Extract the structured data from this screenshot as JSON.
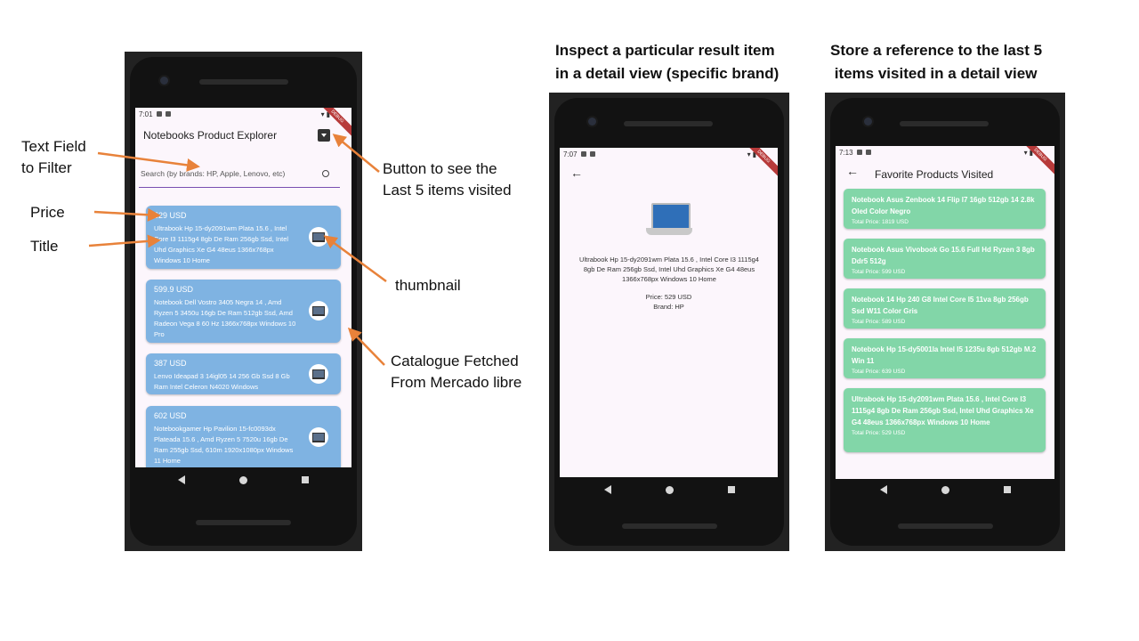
{
  "annotations": {
    "text_field": "Text Field\nto Filter",
    "price": "Price",
    "title": "Title",
    "button": "Button to see the\nLast 5 items visited",
    "thumbnail": "thumbnail",
    "catalogue": "Catalogue Fetched\nFrom Mercado libre",
    "detail_heading": "Inspect a particular result item\nin a detail view (specific brand)",
    "favorites_heading": "Store a reference to the last 5\n items visited in a detail view"
  },
  "colors": {
    "card_blue": "#7fb3e2",
    "card_green": "#82d6a8",
    "arrow": "#e8823a",
    "screen_bg": "#fcf6fc"
  },
  "phone1": {
    "status_time": "7:01",
    "app_title": "Notebooks Product Explorer",
    "favorites_button_icon": "archive-icon",
    "search_placeholder": "Search (by brands: HP, Apple, Lenovo, etc)",
    "products": [
      {
        "price": "529 USD",
        "title": "Ultrabook  Hp 15-dy2091wm Plata 15.6 , Intel Core I3 1115g4  8gb De Ram 256gb Ssd, Intel Uhd Graphics Xe G4 48eus 1366x768px Windows 10 Home"
      },
      {
        "price": "599.9 USD",
        "title": "Notebook Dell Vostro 3405 Negra 14 , Amd Ryzen 5 3450u  16gb De Ram 512gb Ssd, Amd Radeon Vega 8 60 Hz 1366x768px Windows 10 Pro"
      },
      {
        "price": "387 USD",
        "title": "Lenvo Ideapad 3 14igl05 14  256 Gb Ssd 8 Gb Ram Intel Celeron N4020 Windows"
      },
      {
        "price": "602 USD",
        "title": "Notebookgamer  Hp Pavilion 15-fc0093dx Plateada 15.6 , Amd Ryzen 5 7520u  16gb De Ram 255gb Ssd, 610m 1920x1080px Windows 11 Home"
      }
    ]
  },
  "phone2": {
    "status_time": "7:07",
    "title": "Ultrabook  Hp 15-dy2091wm Plata 15.6 , Intel Core I3 1115g4  8gb De Ram 256gb Ssd, Intel Uhd Graphics Xe G4 48eus 1366x768px Windows 10 Home",
    "price": "Price: 529 USD",
    "brand": "Brand: HP"
  },
  "phone3": {
    "status_time": "7:13",
    "app_title": "Favorite Products Visited",
    "favorites": [
      {
        "title": "Notebook Asus Zenbook 14 Flip I7 16gb 512gb 14  2.8k Oled Color Negro",
        "price": "Total Price: 1819 USD"
      },
      {
        "title": "Notebook Asus Vivobook Go 15.6 Full Hd Ryzen 3 8gb Ddr5 512g",
        "price": "Total Price: 599 USD"
      },
      {
        "title": "Notebook 14 Hp 240 G8 Intel Core I5 11va 8gb 256gb Ssd W11 Color Gris",
        "price": "Total Price: 589 USD"
      },
      {
        "title": "Notebook Hp 15-dy5001la Intel I5 1235u 8gb 512gb M.2 Win 11",
        "price": "Total Price: 639 USD"
      },
      {
        "title": "Ultrabook  Hp 15-dy2091wm Plata 15.6 , Intel Core I3 1115g4  8gb De Ram 256gb Ssd, Intel Uhd Graphics Xe G4 48eus 1366x768px Windows 10 Home",
        "price": "Total Price: 529 USD"
      }
    ]
  }
}
